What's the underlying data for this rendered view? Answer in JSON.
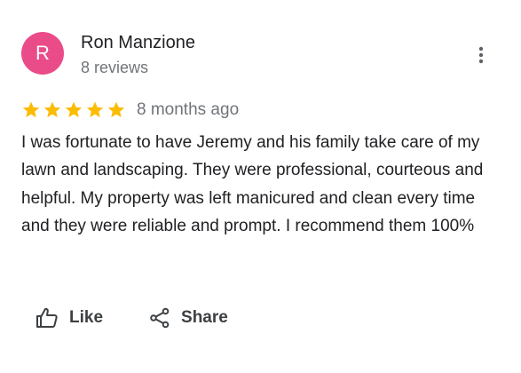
{
  "reviewer": {
    "initial": "R",
    "avatar_color": "#ea4c89",
    "name": "Ron Manzione",
    "review_count": "8 reviews"
  },
  "review": {
    "rating": 5,
    "max_rating": 5,
    "star_color": "#fbbc04",
    "time_ago": "8 months ago",
    "text": "I was fortunate to have Jeremy and his family take care of my lawn and landscaping. They were professional, courteous and helpful. My property was left manicured and clean every time and they were reliable and prompt. I recommend them 100%"
  },
  "actions": {
    "like_label": "Like",
    "share_label": "Share"
  },
  "icons": {
    "menu": "more-vert-icon",
    "like": "thumb-up-icon",
    "share": "share-icon",
    "star": "star-icon"
  }
}
